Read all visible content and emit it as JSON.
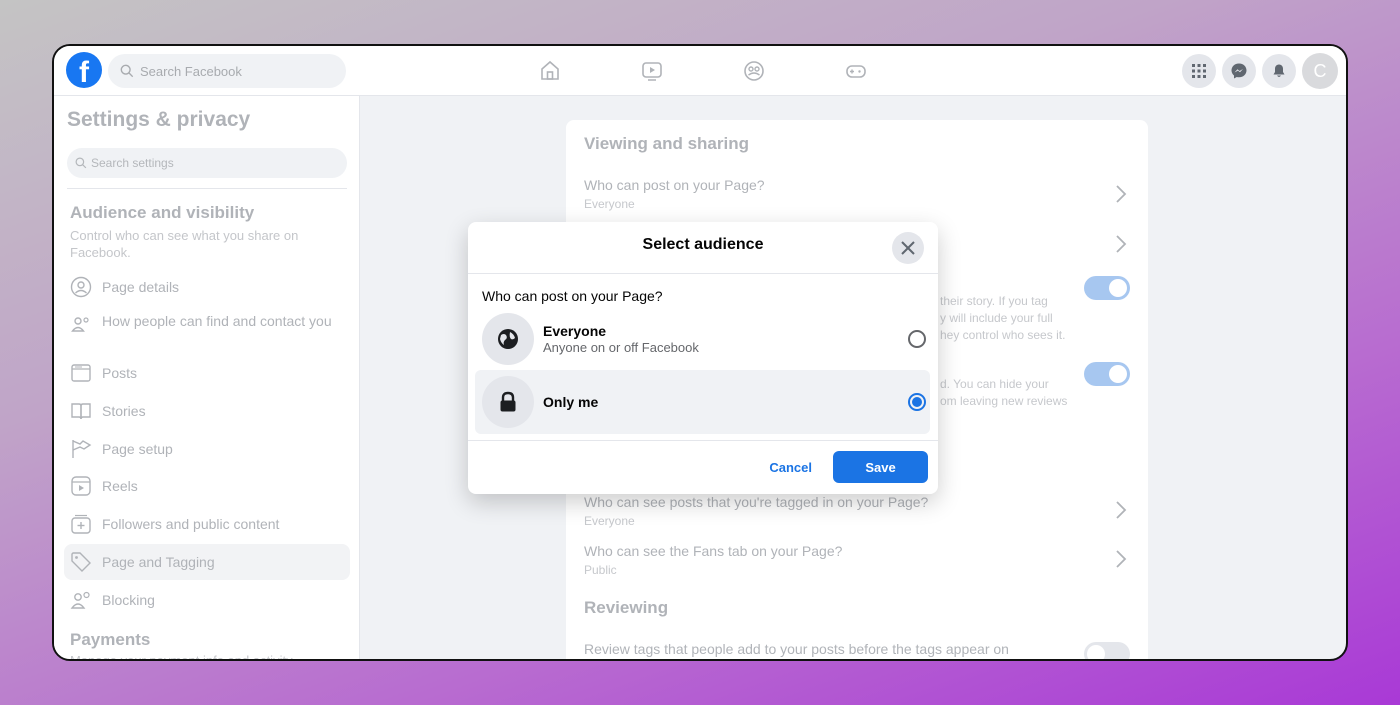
{
  "topbar": {
    "logo_letter": "f",
    "search_placeholder": "Search Facebook",
    "nav_icons": [
      "home-icon",
      "video-icon",
      "groups-icon",
      "gaming-icon"
    ],
    "right_icons": [
      "menu-grid-icon",
      "messenger-icon",
      "notifications-icon"
    ],
    "avatar_letter": "C"
  },
  "sidebar": {
    "title": "Settings & privacy",
    "search_placeholder": "Search settings",
    "section_title": "Audience and visibility",
    "section_desc": "Control who can see what you share on Facebook.",
    "items": [
      {
        "label": "Page details",
        "icon": "user-circle-icon"
      },
      {
        "label": "How people can find and contact you",
        "icon": "people-icon"
      },
      {
        "label": "Posts",
        "icon": "posts-icon"
      },
      {
        "label": "Stories",
        "icon": "book-icon"
      },
      {
        "label": "Page setup",
        "icon": "flag-icon"
      },
      {
        "label": "Reels",
        "icon": "reels-icon"
      },
      {
        "label": "Followers and public content",
        "icon": "followers-icon"
      },
      {
        "label": "Page and Tagging",
        "icon": "tag-icon"
      },
      {
        "label": "Blocking",
        "icon": "blocking-icon"
      }
    ],
    "payments_title": "Payments",
    "payments_desc": "Manage your payment info and activity."
  },
  "content": {
    "viewing_heading": "Viewing and sharing",
    "row1_title": "Who can post on your Page?",
    "row1_sub": "Everyone",
    "frag_a": [
      "their story. If you tag",
      "y will include your full",
      "hey control who sees it."
    ],
    "frag_b": [
      "d. You can hide your",
      "om leaving new reviews"
    ],
    "row_tagged_title": "Who can see posts that you're tagged in on your Page?",
    "row_tagged_sub": "Everyone",
    "row_fans_title": "Who can see the Fans tab on your Page?",
    "row_fans_sub": "Public",
    "reviewing_heading": "Reviewing",
    "review_row_title": "Review tags that people add to your posts before the tags appear on"
  },
  "modal": {
    "title": "Select audience",
    "question": "Who can post on your Page?",
    "options": [
      {
        "label": "Everyone",
        "sub": "Anyone on or off Facebook",
        "icon": "globe-icon",
        "selected": false
      },
      {
        "label": "Only me",
        "sub": "",
        "icon": "lock-icon",
        "selected": true
      }
    ],
    "cancel_label": "Cancel",
    "save_label": "Save",
    "accent": "#1b74e4"
  }
}
